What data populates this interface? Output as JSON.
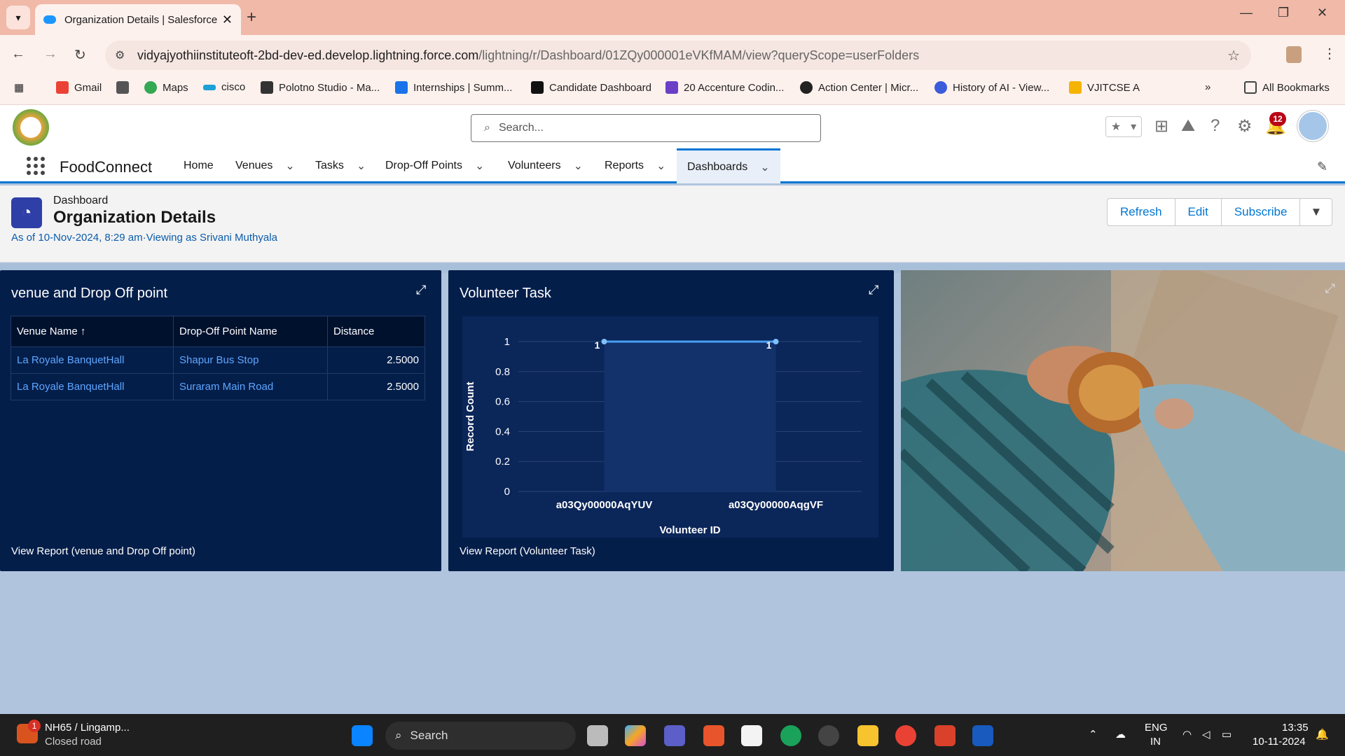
{
  "browser": {
    "tab_title": "Organization Details | Salesforce",
    "url_domain": "vidyajyothiinstituteoft-2bd-dev-ed.develop.lightning.force.com",
    "url_path": "/lightning/r/Dashboard/01ZQy000001eVKfMAM/view?queryScope=userFolders",
    "bookmarks": [
      "Gmail",
      "Maps",
      "cisco",
      "Polotno Studio - Ma...",
      "Internships | Summ...",
      "Candidate Dashboard",
      "20 Accenture Codin...",
      "Action Center | Micr...",
      "History of AI - View...",
      "VJITCSE A"
    ],
    "all_bookmarks": "All Bookmarks"
  },
  "sf": {
    "search_placeholder": "Search...",
    "notification_count": "12",
    "app_name": "FoodConnect",
    "nav": [
      "Home",
      "Venues",
      "Tasks",
      "Drop-Off Points",
      "Volunteers",
      "Reports",
      "Dashboards"
    ]
  },
  "page": {
    "label": "Dashboard",
    "title": "Organization Details",
    "subtitle": "As of 10-Nov-2024, 8:29 am·Viewing as Srivani Muthyala",
    "buttons": {
      "refresh": "Refresh",
      "edit": "Edit",
      "subscribe": "Subscribe"
    }
  },
  "panel1": {
    "title": "venue and Drop Off point",
    "columns": [
      "Venue Name ↑",
      "Drop-Off Point Name",
      "Distance"
    ],
    "rows": [
      [
        "La Royale BanquetHall",
        "Shapur Bus Stop",
        "2.5000"
      ],
      [
        "La Royale BanquetHall",
        "Suraram Main Road",
        "2.5000"
      ]
    ],
    "link": "View Report (venue and Drop Off point)"
  },
  "panel2": {
    "title": "Volunteer Task",
    "link": "View Report (Volunteer Task)"
  },
  "chart_data": {
    "type": "line",
    "categories": [
      "a03Qy00000AqYUV",
      "a03Qy00000AqgVF"
    ],
    "values": [
      1,
      1
    ],
    "data_labels": [
      "1",
      "1"
    ],
    "xlabel": "Volunteer ID",
    "ylabel": "Record Count",
    "ylim": [
      0,
      1
    ],
    "yticks": [
      "0",
      "0.2",
      "0.4",
      "0.6",
      "0.8",
      "1"
    ],
    "grid": true
  },
  "taskbar": {
    "traffic_title": "NH65 / Lingamp...",
    "traffic_sub": "Closed road",
    "traffic_badge": "1",
    "search": "Search",
    "lang1": "ENG",
    "lang2": "IN",
    "time": "13:35",
    "date": "10-11-2024"
  }
}
